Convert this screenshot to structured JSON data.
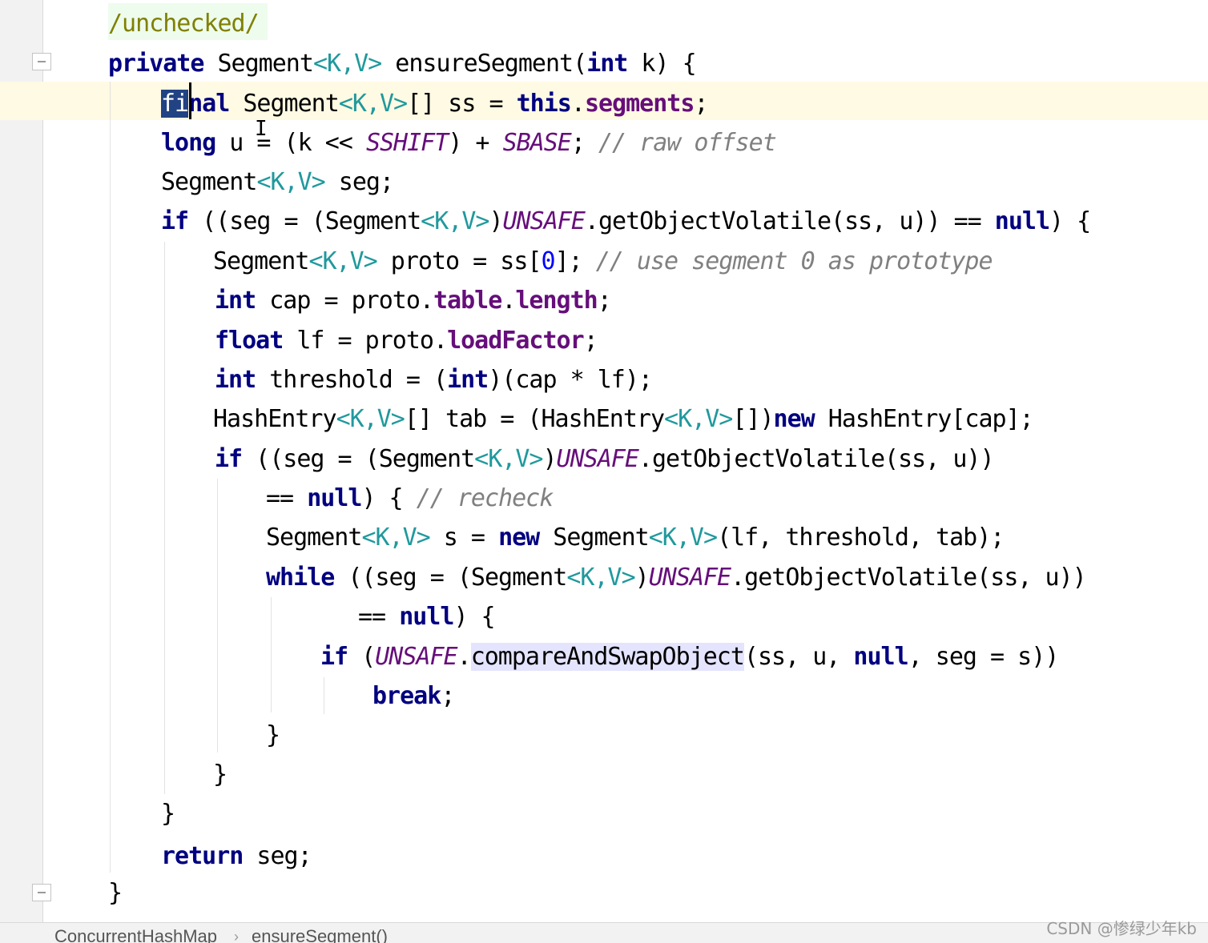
{
  "editor": {
    "code_lines": [
      [
        [
          "/unchecked/",
          "anno"
        ]
      ],
      [
        [
          "private",
          "kw"
        ],
        [
          " Segment",
          ""
        ],
        [
          "<K,V>",
          "generic"
        ],
        [
          " ensureSegment(",
          ""
        ],
        [
          "int",
          "kw"
        ],
        [
          " k) {",
          ""
        ]
      ],
      [
        [
          "fi",
          "word-sel"
        ],
        [
          "nal",
          "kw"
        ],
        [
          " Segment",
          ""
        ],
        [
          "<K,V>",
          "generic"
        ],
        [
          "[] ss = ",
          ""
        ],
        [
          "this",
          "kw"
        ],
        [
          ".",
          ""
        ],
        [
          "segments",
          "field"
        ],
        [
          ";",
          ""
        ]
      ],
      [
        [
          "long",
          "kw"
        ],
        [
          " u = (k << ",
          ""
        ],
        [
          "SSHIFT",
          "static"
        ],
        [
          ") + ",
          ""
        ],
        [
          "SBASE",
          "static"
        ],
        [
          "; ",
          ""
        ],
        [
          "// raw offset",
          "comment"
        ]
      ],
      [
        [
          "Segment",
          ""
        ],
        [
          "<K,V>",
          "generic"
        ],
        [
          " seg;",
          ""
        ]
      ],
      [
        [
          "if",
          "kw"
        ],
        [
          " ((seg = (Segment",
          ""
        ],
        [
          "<K,V>",
          "generic"
        ],
        [
          ")",
          ""
        ],
        [
          "UNSAFE",
          "static"
        ],
        [
          ".getObjectVolatile(ss, u)) == ",
          ""
        ],
        [
          "null",
          "kw"
        ],
        [
          ") {",
          ""
        ]
      ],
      [
        [
          "Segment",
          ""
        ],
        [
          "<K,V>",
          "generic"
        ],
        [
          " proto = ss[",
          ""
        ],
        [
          "0",
          "num"
        ],
        [
          "]; ",
          ""
        ],
        [
          "// use segment 0 as prototype",
          "comment"
        ]
      ],
      [
        [
          "int",
          "kw"
        ],
        [
          " cap = proto.",
          ""
        ],
        [
          "table",
          "field"
        ],
        [
          ".",
          ""
        ],
        [
          "length",
          "field"
        ],
        [
          ";",
          ""
        ]
      ],
      [
        [
          "float",
          "kw"
        ],
        [
          " lf = proto.",
          ""
        ],
        [
          "loadFactor",
          "field"
        ],
        [
          ";",
          ""
        ]
      ],
      [
        [
          "int",
          "kw"
        ],
        [
          " threshold = (",
          ""
        ],
        [
          "int",
          "kw"
        ],
        [
          ")(cap * lf);",
          ""
        ]
      ],
      [
        [
          "HashEntry",
          ""
        ],
        [
          "<K,V>",
          "generic"
        ],
        [
          "[] tab = (HashEntry",
          ""
        ],
        [
          "<K,V>",
          "generic"
        ],
        [
          "[])",
          ""
        ],
        [
          "new",
          "kw"
        ],
        [
          " HashEntry[cap];",
          ""
        ]
      ],
      [
        [
          "if",
          "kw"
        ],
        [
          " ((seg = (Segment",
          ""
        ],
        [
          "<K,V>",
          "generic"
        ],
        [
          ")",
          ""
        ],
        [
          "UNSAFE",
          "static"
        ],
        [
          ".getObjectVolatile(ss, u))",
          ""
        ]
      ],
      [
        [
          "== ",
          ""
        ],
        [
          "null",
          "kw"
        ],
        [
          ") { ",
          ""
        ],
        [
          "// recheck",
          "comment"
        ]
      ],
      [
        [
          "Segment",
          ""
        ],
        [
          "<K,V>",
          "generic"
        ],
        [
          " s = ",
          ""
        ],
        [
          "new",
          "kw"
        ],
        [
          " Segment",
          ""
        ],
        [
          "<K,V>",
          "generic"
        ],
        [
          "(lf, threshold, tab);",
          ""
        ]
      ],
      [
        [
          "while",
          "kw"
        ],
        [
          " ((seg = (Segment",
          ""
        ],
        [
          "<K,V>",
          "generic"
        ],
        [
          ")",
          ""
        ],
        [
          "UNSAFE",
          "static"
        ],
        [
          ".getObjectVolatile(ss, u))",
          ""
        ]
      ],
      [
        [
          "== ",
          ""
        ],
        [
          "null",
          "kw"
        ],
        [
          ") {",
          ""
        ]
      ],
      [
        [
          "if",
          "kw"
        ],
        [
          " (",
          ""
        ],
        [
          "UNSAFE",
          "static"
        ],
        [
          ".",
          ""
        ],
        [
          "compareAndSwapObject",
          "sel-highlight"
        ],
        [
          "(ss, u, ",
          ""
        ],
        [
          "null",
          "kw"
        ],
        [
          ", seg = s))",
          ""
        ]
      ],
      [
        [
          "break",
          "kw"
        ],
        [
          ";",
          ""
        ]
      ],
      [
        [
          "}",
          ""
        ]
      ],
      [
        [
          "}",
          ""
        ]
      ],
      [
        [
          "}",
          ""
        ]
      ],
      [
        [
          "return",
          "kw"
        ],
        [
          " seg;",
          ""
        ]
      ],
      [
        [
          "}",
          ""
        ]
      ]
    ]
  },
  "breadcrumb": {
    "class_name": "ConcurrentHashMap",
    "separator": "›",
    "method_name": "ensureSegment()"
  },
  "watermark": "CSDN @惨绿少年kb",
  "colors": {
    "keyword": "#000080",
    "field": "#660e7a",
    "comment": "#808080",
    "generic": "#20999d",
    "annotation": "#808000",
    "current_line": "#fffae3",
    "usage_highlight": "#e4e4ff"
  },
  "icons": [
    "fold-open-icon",
    "fold-close-icon",
    "text-cursor-icon"
  ]
}
